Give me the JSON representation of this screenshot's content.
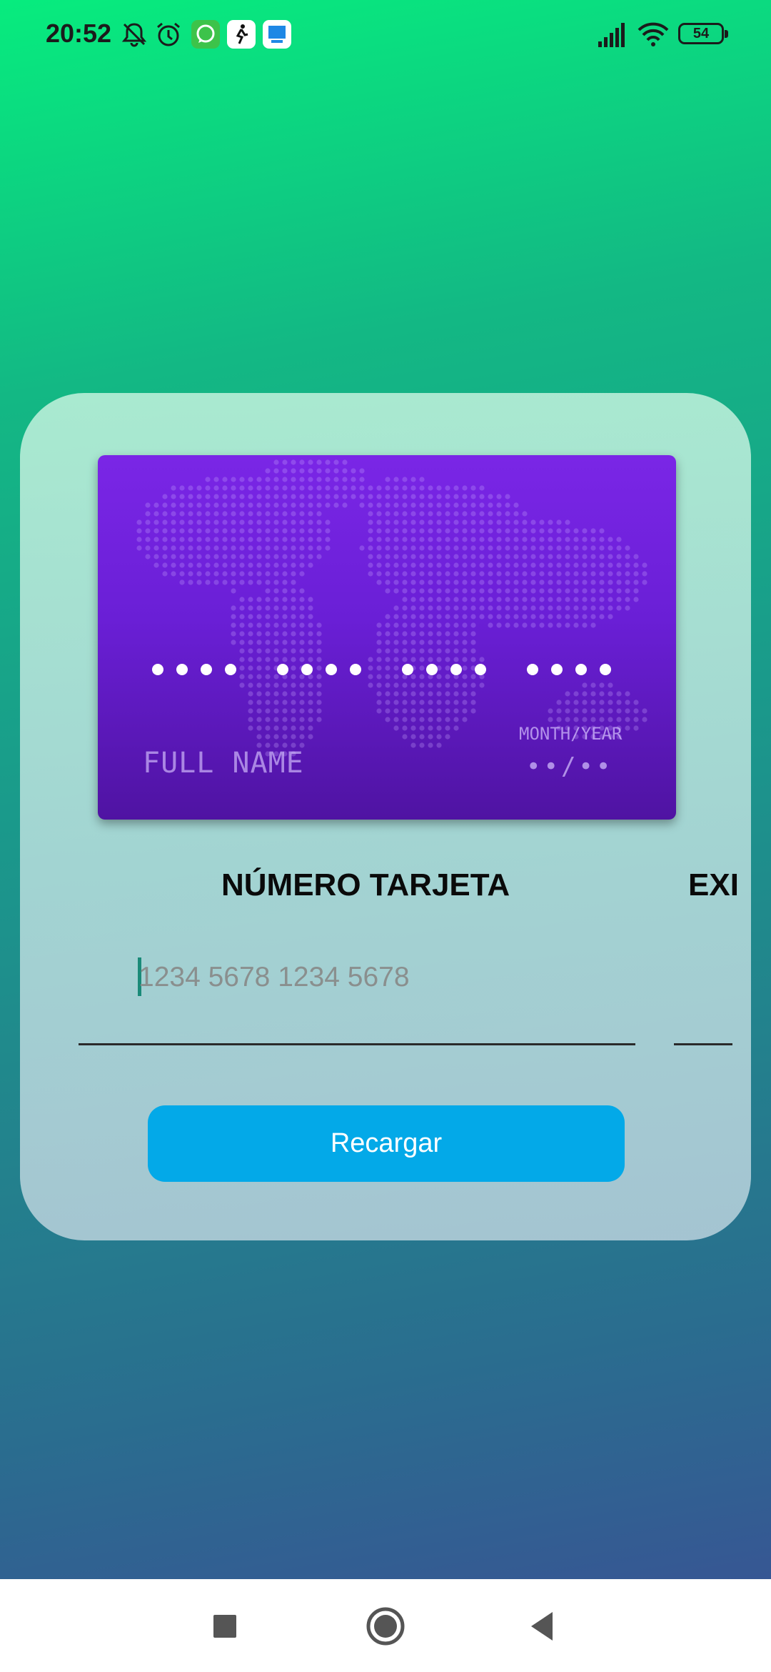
{
  "status_bar": {
    "time": "20:52",
    "battery": "54",
    "icons": [
      "bell-muted-icon",
      "alarm-icon",
      "whatsapp-icon",
      "app-icon-runner",
      "app-icon-blue",
      "signal-icon",
      "wifi-icon",
      "battery-icon"
    ]
  },
  "card_preview": {
    "number_mask": "•••• •••• •••• ••••",
    "name_placeholder": "FULL NAME",
    "expiry_label": "MONTH/YEAR",
    "expiry_mask": "••/••"
  },
  "form": {
    "card_number_label": "NÚMERO TARJETA",
    "expiry_label_partial": "EXI",
    "card_number_placeholder": "1234 5678 1234 5678",
    "card_number_value": ""
  },
  "actions": {
    "reload_label": "Recargar"
  },
  "nav_bar": {
    "buttons": [
      "recents-icon",
      "home-icon",
      "back-icon"
    ]
  },
  "colors": {
    "gradient_top": "#07ec7e",
    "gradient_bottom": "#3b4f95",
    "card_purple": "#6a1fd6",
    "button_blue": "#03a9e8",
    "caret_teal": "#1a8a78"
  }
}
